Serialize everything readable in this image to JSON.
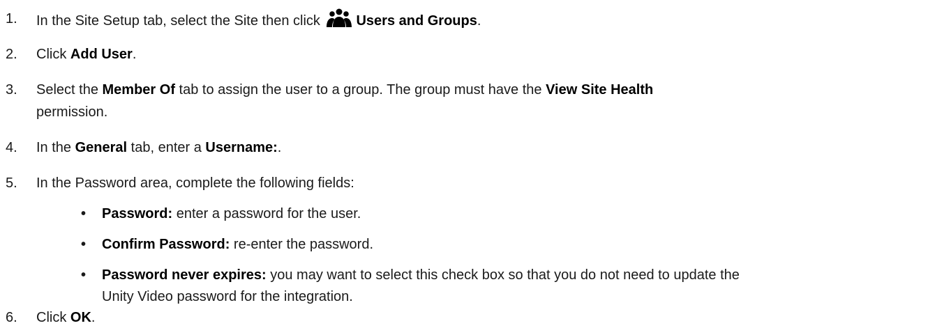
{
  "steps": [
    {
      "number": "1.",
      "before": "In the Site Setup tab, select the Site then click",
      "icon": "users-group-icon",
      "bold": "Users and Groups",
      "after": "."
    },
    {
      "number": "2.",
      "before": "Click",
      "bold": "Add User",
      "after": "."
    },
    {
      "number": "3.",
      "before": "Select the",
      "bold1": "Member Of",
      "middle": "tab to assign the user to a group. The group must have the",
      "bold2": "View Site Health",
      "line2": "permission."
    },
    {
      "number": "4.",
      "before": "In the",
      "bold1": "General",
      "middle": "tab, enter a",
      "bold2": "Username:",
      "after": "."
    },
    {
      "number": "5.",
      "text": "In the Password area, complete the following fields:",
      "bullets": [
        {
          "bold": "Password:",
          "text": "enter a password for the user."
        },
        {
          "bold": "Confirm Password:",
          "text": "re-enter the password."
        },
        {
          "bold": "Password never expires:",
          "text": "you may want to select this check box so that you do not need to update the",
          "line2": "Unity Video password for the integration."
        }
      ]
    },
    {
      "number": "6.",
      "before": "Click",
      "bold": "OK",
      "after": "."
    }
  ],
  "bullet_symbol": "•"
}
